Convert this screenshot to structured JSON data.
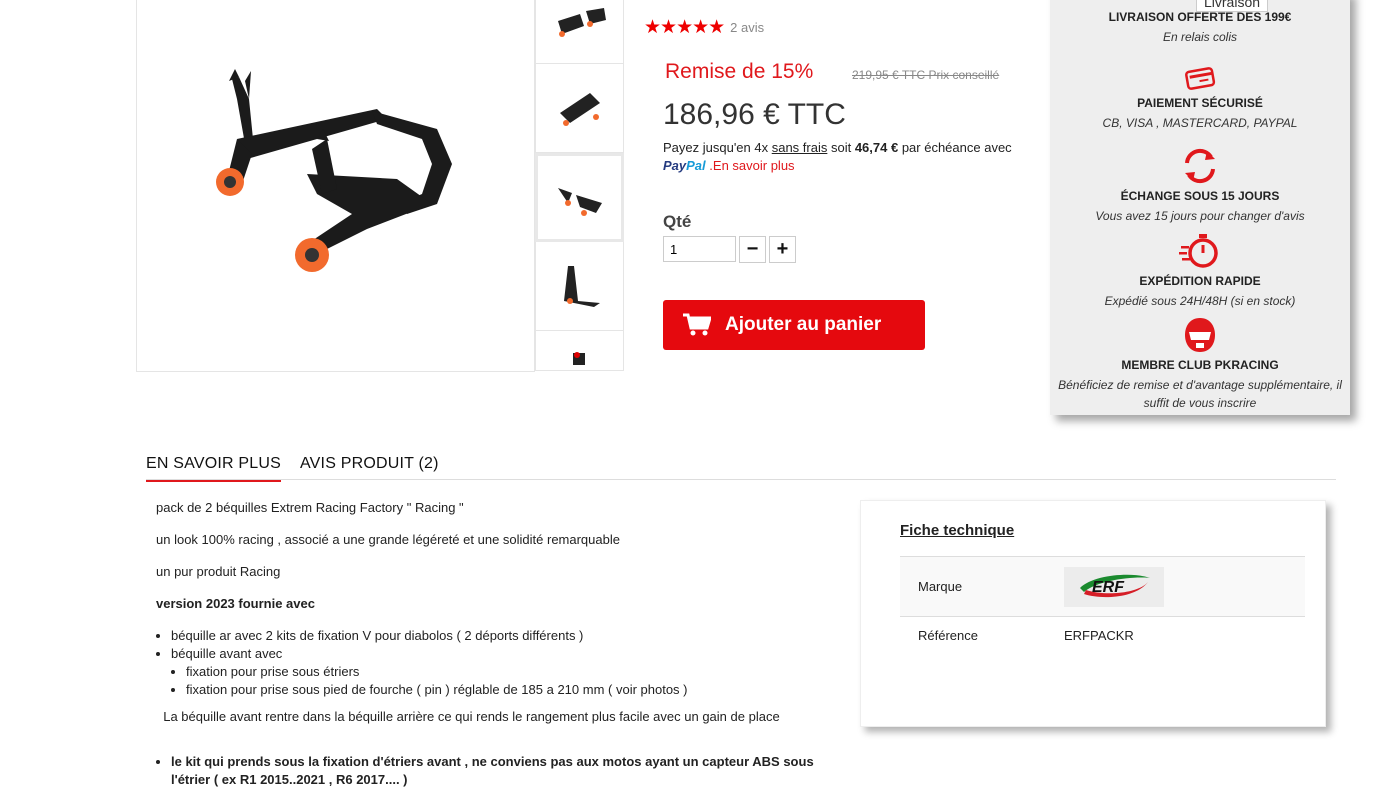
{
  "product": {
    "rating_stars": "★★★★★",
    "rating_count": "2 avis",
    "discount": "Remise de 15%",
    "old_price": "219,95 € TTC Prix conseillé",
    "price": "186,96 € TTC",
    "paypal": {
      "prefix": "Payez jusqu'en 4x ",
      "no_fees": "sans frais",
      "middle": " soit ",
      "installment": "46,74 €",
      "suffix": " par échéance avec",
      "logo_pay": "Pay",
      "logo_pal": "Pal",
      "learn_more": ".En savoir plus"
    },
    "qty_label": "Qté",
    "qty_value": "1",
    "minus": "−",
    "plus": "+",
    "add_to_cart": "Ajouter au panier"
  },
  "reassurance": {
    "tooltip": "Livraison",
    "items": [
      {
        "icon": "delivery-icon",
        "title": "LIVRAISON OFFERTE DES 199€",
        "sub": "En relais colis"
      },
      {
        "icon": "credit-card-icon",
        "title": "PAIEMENT SÉCURISÉ",
        "sub": "CB, VISA , MASTERCARD, PAYPAL"
      },
      {
        "icon": "exchange-icon",
        "title": "ÉCHANGE SOUS 15 JOURS",
        "sub": "Vous avez 15 jours pour changer d'avis"
      },
      {
        "icon": "fast-shipping-icon",
        "title": "EXPÉDITION RAPIDE",
        "sub": "Expédié sous 24H/48H (si en stock)"
      },
      {
        "icon": "helmet-icon",
        "title": "MEMBRE CLUB PKRACING",
        "sub": "Bénéficiez de remise et d'avantage supplémentaire, il suffit de vous inscrire"
      }
    ],
    "accent": "#e0181c"
  },
  "tabs": [
    {
      "label": "EN SAVOIR PLUS"
    },
    {
      "label": "AVIS PRODUIT (2)"
    }
  ],
  "description": {
    "p1": "pack de 2 béquilles Extrem Racing Factory  \" Racing \"",
    "p2": "un look 100% racing , associé a une grande légéreté et une solidité remarquable",
    "p3": "un pur produit Racing",
    "p4": "version 2023 fournie avec",
    "li1": "béquille ar avec 2 kits de fixation V pour diabolos ( 2 déports différents )",
    "li2": "béquille avant avec",
    "li2a": "fixation pour prise sous étriers",
    "li2b": "fixation pour prise sous pied de fourche ( pin ) réglable de 185 a 210 mm ( voir photos )",
    "p5": "  La béquille avant rentre dans la béquille arrière ce qui rends le rangement plus facile avec un gain de place",
    "li3": " le kit qui prends sous la fixation d'étriers avant ,  ne conviens pas aux motos ayant un capteur ABS sous l'étrier ( ex R1 2015..2021 , R6 2017....  )"
  },
  "fiche": {
    "title": "Fiche technique",
    "rows": [
      {
        "key": "Marque",
        "value": ""
      },
      {
        "key": "Référence",
        "value": "ERFPACKR"
      }
    ],
    "brand_logo_text": "ERF"
  }
}
